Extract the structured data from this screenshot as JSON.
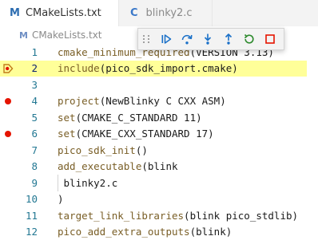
{
  "tabs": [
    {
      "icon": "M",
      "label": "CMakeLists.txt",
      "active": true
    },
    {
      "icon": "C",
      "label": "blinky2.c",
      "active": false
    }
  ],
  "breadcrumb": {
    "icon": "M",
    "label": "CMakeLists.txt"
  },
  "debug_toolbar": {
    "buttons": [
      "continue",
      "step-over",
      "step-into",
      "step-out",
      "restart",
      "stop"
    ]
  },
  "colors": {
    "accent": "#2b6cb0",
    "breakpoint": "#e51400",
    "current_line": "#ffff99",
    "debug_blue": "#1a70c8",
    "restart_green": "#2d8a2d",
    "stop_red": "#e51400"
  },
  "editor": {
    "lines": [
      {
        "num": "1",
        "fn": "cmake_minimum_required",
        "rest": "(VERSION 3.13)",
        "breakpoint": false,
        "current": false
      },
      {
        "num": "2",
        "fn": "include",
        "rest": "(pico_sdk_import.cmake)",
        "breakpoint": false,
        "current": true
      },
      {
        "num": "3",
        "fn": "",
        "rest": "",
        "breakpoint": false,
        "current": false
      },
      {
        "num": "4",
        "fn": "project",
        "rest": "(NewBlinky C CXX ASM)",
        "breakpoint": true,
        "current": false
      },
      {
        "num": "5",
        "fn": "set",
        "rest": "(CMAKE_C_STANDARD 11)",
        "breakpoint": false,
        "current": false
      },
      {
        "num": "6",
        "fn": "set",
        "rest": "(CMAKE_CXX_STANDARD 17)",
        "breakpoint": true,
        "current": false
      },
      {
        "num": "7",
        "fn": "pico_sdk_init",
        "rest": "()",
        "breakpoint": false,
        "current": false
      },
      {
        "num": "8",
        "fn": "add_executable",
        "rest": "(blink",
        "breakpoint": false,
        "current": false
      },
      {
        "num": "9",
        "fn": "",
        "rest": " blinky2.c",
        "breakpoint": false,
        "current": false
      },
      {
        "num": "10",
        "fn": "",
        "rest": ")",
        "breakpoint": false,
        "current": false
      },
      {
        "num": "11",
        "fn": "target_link_libraries",
        "rest": "(blink pico_stdlib)",
        "breakpoint": false,
        "current": false
      },
      {
        "num": "12",
        "fn": "pico_add_extra_outputs",
        "rest": "(blink)",
        "breakpoint": false,
        "current": false
      }
    ]
  }
}
